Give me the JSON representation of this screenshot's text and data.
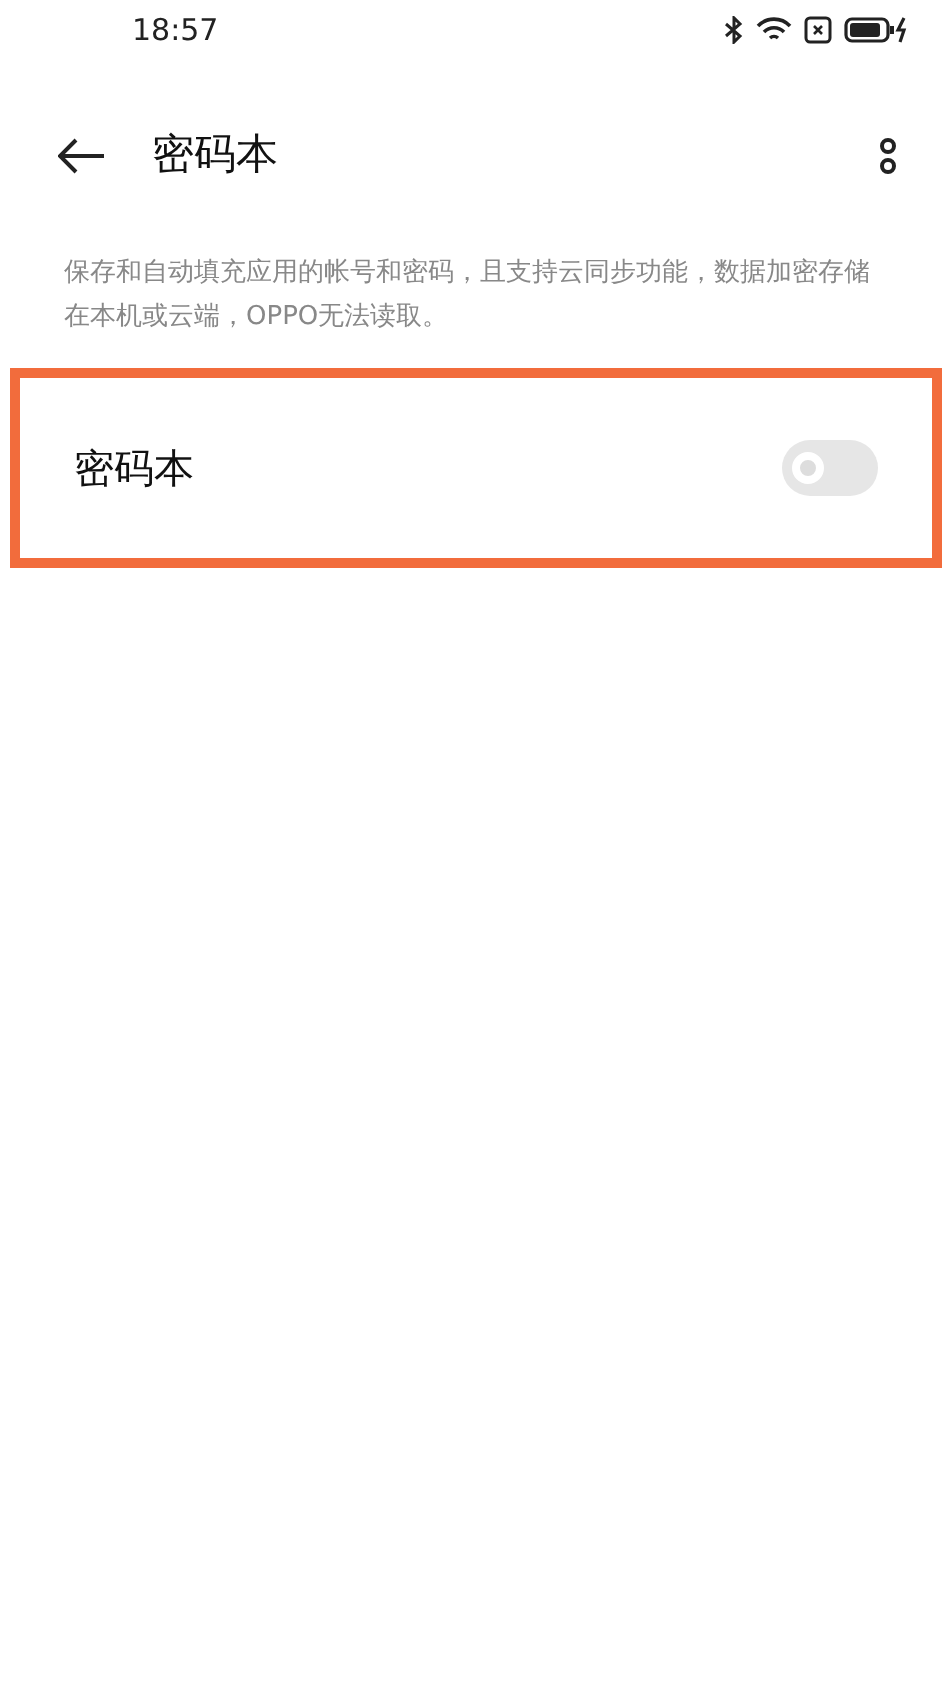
{
  "status_bar": {
    "time": "18:57"
  },
  "header": {
    "title": "密码本"
  },
  "description": "保存和自动填充应用的帐号和密码，且支持云同步功能，数据加密存储在本机或云端，OPPO无法读取。",
  "setting": {
    "label": "密码本",
    "on": false,
    "highlighted": true
  }
}
